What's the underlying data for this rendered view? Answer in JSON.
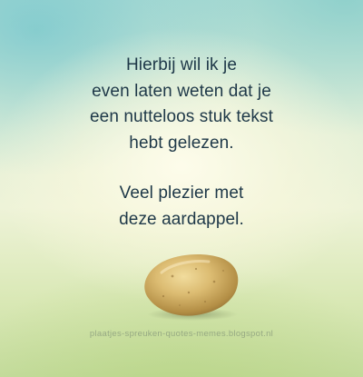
{
  "message": {
    "paragraph_1": [
      "Hierbij wil ik je",
      "even laten weten dat je",
      "een nutteloos stuk tekst",
      "hebt gelezen."
    ],
    "paragraph_2": [
      "Veel plezier met",
      "deze aardappel."
    ]
  },
  "watermark": "plaatjes-spreuken-quotes-memes.blogspot.nl",
  "colors": {
    "text": "#1e3848",
    "potato_skin": "#c9a55a",
    "background_top": "#b8e0d6",
    "background_bottom": "#c5dc9e"
  },
  "icons": {
    "potato": "potato-icon"
  }
}
